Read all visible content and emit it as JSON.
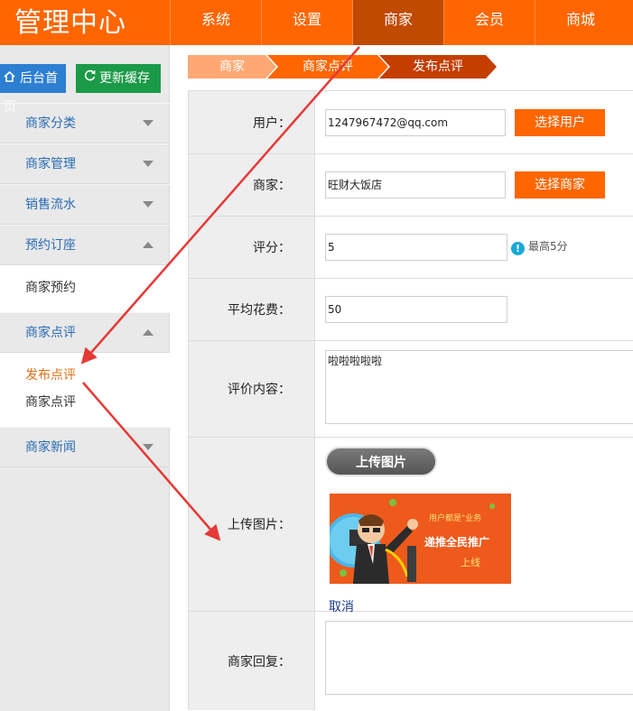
{
  "header": {
    "brand": "管理中心",
    "tabs": [
      "系统",
      "设置",
      "商家",
      "会员",
      "商城"
    ],
    "active_tab": "商家"
  },
  "sidebar": {
    "home_button": "后台首页",
    "cache_button": "更新缓存",
    "groups": {
      "g1": "商家分类",
      "g2": "商家管理",
      "g3": "销售流水",
      "g4": "预约订座",
      "g4_items": [
        "商家预约"
      ],
      "g5": "商家点评",
      "g5_items": [
        "发布点评",
        "商家点评"
      ],
      "g6": "商家新闻"
    }
  },
  "breadcrumb": [
    "商家",
    "商家点评",
    "发布点评"
  ],
  "form": {
    "user_label": "用户：",
    "user_value": "1247967472@qq.com",
    "select_user": "选择用户",
    "merchant_label": "商家：",
    "merchant_value": "旺财大饭店",
    "select_merchant": "选择商家",
    "score_label": "评分：",
    "score_value": "5",
    "score_hint": "最高5分",
    "avg_label": "平均花费：",
    "avg_value": "50",
    "content_label": "评价内容：",
    "content_value": "啦啦啦啦啦",
    "upload_label": "上传图片：",
    "upload_button": "上传图片",
    "image_text_1": "用户都是\"业务",
    "image_text_2": "递推全民推广",
    "image_text_3": "上线",
    "cancel": "取消",
    "reply_label": "商家回复："
  },
  "colors": {
    "brand_orange": "#ff6600",
    "active_tab": "#c04a00",
    "annotation_red": "#e53935",
    "menu_blue": "#2a6bb5"
  }
}
